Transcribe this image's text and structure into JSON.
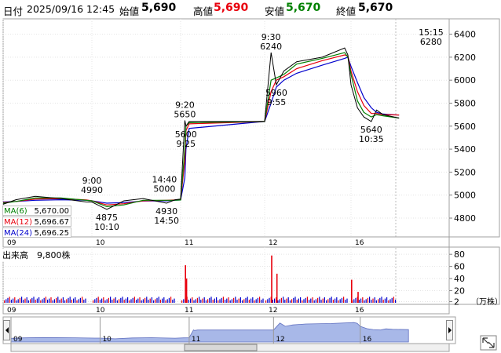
{
  "header": {
    "date_label": "日付",
    "datetime": "2025/09/16 12:45",
    "open_label": "始値",
    "open_value": "5,690",
    "high_label": "高値",
    "high_value": "5,690",
    "low_label": "安値",
    "low_value": "5,670",
    "close_label": "終値",
    "close_value": "5,670"
  },
  "moving_averages": [
    {
      "label": "MA(6)",
      "value": "5,670.00",
      "color": "#008000"
    },
    {
      "label": "MA(12)",
      "value": "5,696.67",
      "color": "#e8000d"
    },
    {
      "label": "MA(24)",
      "value": "5,696.25",
      "color": "#0000cc"
    }
  ],
  "volume_label": "出来高　9,800株",
  "volume_unit": "（万株）",
  "colors": {
    "up": "#e8000d",
    "down": "#0000cc",
    "ma6": "#008000",
    "ma12": "#e8000d",
    "ma24": "#0000cc",
    "nav_fill": "#a8b8e8"
  },
  "chart_data": [
    {
      "type": "line",
      "panel": "price",
      "days": [
        "09",
        "10",
        "11",
        "12",
        "16"
      ],
      "x": [
        "09 09:00",
        "09 10:00",
        "09 11:30",
        "09 13:30",
        "09 15:30",
        "10 09:00",
        "10 10:10",
        "10 11:30",
        "10 13:00",
        "10 14:50",
        "10 15:30",
        "11 09:00",
        "11 09:20",
        "11 09:25",
        "11 09:40",
        "11 15:30",
        "12 09:00",
        "12 09:30",
        "12 09:55",
        "12 10:30",
        "12 11:30",
        "12 13:30",
        "12 15:15",
        "12 15:30",
        "16 09:00",
        "16 09:30",
        "16 10:00",
        "16 10:35",
        "16 11:00",
        "16 11:30",
        "16 12:45"
      ],
      "price": [
        4920,
        4960,
        4990,
        4970,
        4940,
        4940,
        4875,
        4950,
        4970,
        4930,
        4960,
        4965,
        5650,
        5600,
        5640,
        5640,
        5640,
        6240,
        5960,
        6080,
        6160,
        6200,
        6280,
        6220,
        5960,
        5760,
        5680,
        5640,
        5740,
        5700,
        5670
      ],
      "ma6": [
        4930,
        4945,
        4975,
        4975,
        4955,
        4950,
        4900,
        4915,
        4955,
        4955,
        4955,
        4958,
        5400,
        5600,
        5630,
        5640,
        5640,
        6000,
        6020,
        6050,
        6140,
        6190,
        6240,
        6200,
        6050,
        5820,
        5720,
        5680,
        5700,
        5690,
        5670
      ],
      "ma12": [
        4935,
        4945,
        4965,
        4970,
        4958,
        4950,
        4915,
        4925,
        4950,
        4955,
        4958,
        4960,
        5300,
        5560,
        5620,
        5640,
        5640,
        5900,
        6000,
        6030,
        6100,
        6170,
        6220,
        6210,
        6080,
        5900,
        5780,
        5710,
        5710,
        5700,
        5697
      ],
      "ma24": [
        4940,
        4945,
        4955,
        4960,
        4955,
        4950,
        4930,
        4935,
        4948,
        4950,
        4955,
        4958,
        5150,
        5400,
        5580,
        5640,
        5640,
        5800,
        5940,
        6000,
        6060,
        6130,
        6190,
        6200,
        6120,
        5980,
        5850,
        5760,
        5720,
        5705,
        5696
      ],
      "annotations": [
        {
          "x": "10 09:00",
          "time": "9:00",
          "price": "4990",
          "value": 4990,
          "pos": "above"
        },
        {
          "x": "10 10:10",
          "time": "10:10",
          "price": "4875",
          "value": 4875,
          "pos": "below"
        },
        {
          "x": "10 14:40",
          "time": "14:40",
          "price": "5000",
          "value": 5000,
          "pos": "above"
        },
        {
          "x": "10 14:50",
          "time": "14:50",
          "price": "4930",
          "value": 4930,
          "pos": "below"
        },
        {
          "x": "11 09:20",
          "time": "9:20",
          "price": "5650",
          "value": 5650,
          "pos": "above"
        },
        {
          "x": "11 09:25",
          "time": "9:25",
          "price": "5600",
          "value": 5600,
          "pos": "below"
        },
        {
          "x": "12 09:30",
          "time": "9:30",
          "price": "6240",
          "value": 6240,
          "pos": "above"
        },
        {
          "x": "12 09:55",
          "time": "9:55",
          "price": "5960",
          "value": 5960,
          "pos": "below"
        },
        {
          "x": "16 15:15",
          "time": "15:15",
          "price": "6280",
          "value": 6280,
          "pos": "above"
        },
        {
          "x": "16 10:35",
          "time": "10:35",
          "price": "5640",
          "value": 5640,
          "pos": "below"
        }
      ],
      "y_ticks": [
        4800,
        5000,
        5200,
        5400,
        5600,
        5800,
        6000,
        6200,
        6400
      ],
      "ylim": [
        4650,
        6520
      ],
      "grid": true
    },
    {
      "type": "bar",
      "panel": "volume",
      "y_ticks": [
        2,
        20,
        40,
        60,
        80
      ],
      "ylim": [
        0,
        88
      ],
      "spikes": [
        {
          "x": "11 09:20",
          "value": 62,
          "color": "up"
        },
        {
          "x": "11 09:25",
          "value": 40,
          "color": "up"
        },
        {
          "x": "12 09:30",
          "value": 78,
          "color": "up"
        },
        {
          "x": "12 09:55",
          "value": 48,
          "color": "up"
        },
        {
          "x": "16 09:00",
          "value": 38,
          "color": "up"
        },
        {
          "x": "16 09:30",
          "value": 18,
          "color": "up"
        }
      ],
      "baseline": 4
    }
  ]
}
